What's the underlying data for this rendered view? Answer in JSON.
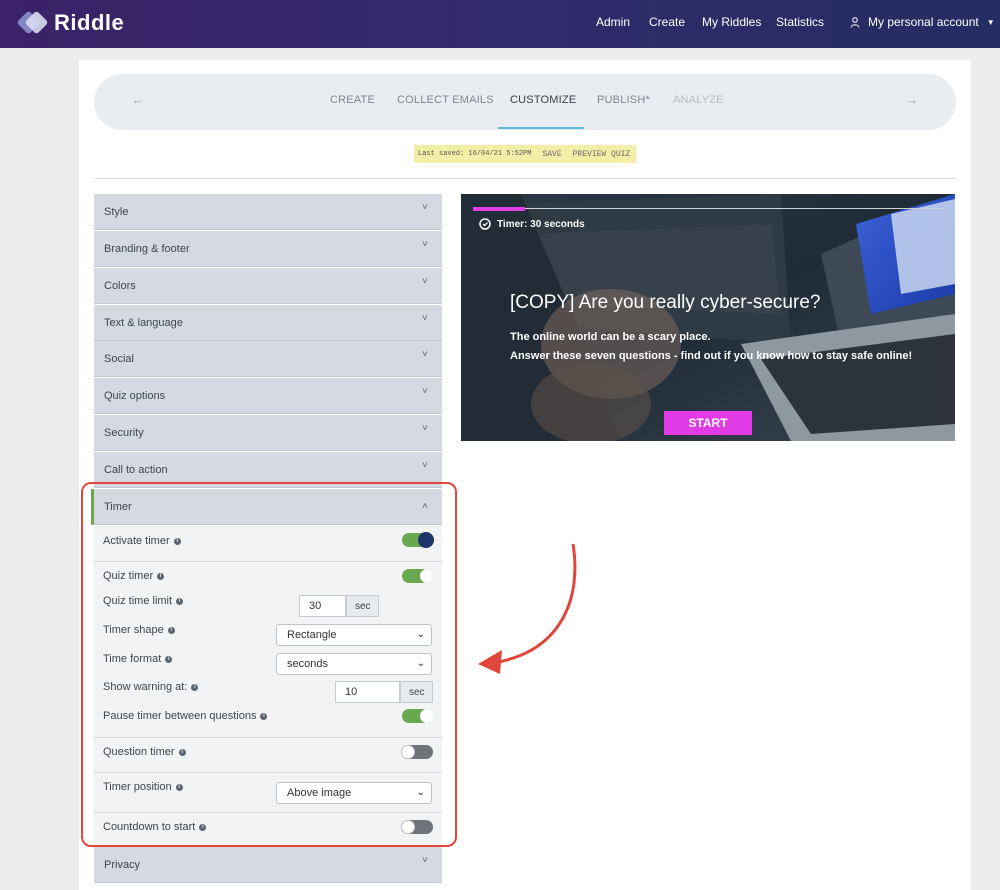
{
  "header": {
    "brand": "Riddle",
    "nav": [
      "Admin",
      "Create",
      "My Riddles",
      "Statistics"
    ],
    "account": "My personal account"
  },
  "steps": {
    "tabs": [
      {
        "label": "CREATE"
      },
      {
        "label": "COLLECT EMAILS"
      },
      {
        "label": "CUSTOMIZE"
      },
      {
        "label": "PUBLISH*"
      },
      {
        "label": "ANALYZE"
      }
    ],
    "active": "CUSTOMIZE"
  },
  "savebar": {
    "last_saved": "Last saved: 16/04/21 5:52PM",
    "save": "SAVE",
    "preview": "PREVIEW QUIZ"
  },
  "accordion": {
    "sections": [
      {
        "label": "Style"
      },
      {
        "label": "Branding & footer"
      },
      {
        "label": "Colors"
      },
      {
        "label": "Text & language"
      },
      {
        "label": "Social"
      },
      {
        "label": "Quiz options"
      },
      {
        "label": "Security"
      },
      {
        "label": "Call to action"
      },
      {
        "label": "Timer"
      },
      {
        "label": "Privacy"
      }
    ],
    "expanded": "Timer"
  },
  "timer": {
    "activate_timer": {
      "label": "Activate timer",
      "on": true
    },
    "quiz_timer": {
      "label": "Quiz timer",
      "on": true
    },
    "quiz_time_limit": {
      "label": "Quiz time limit",
      "value": "30",
      "unit": "sec"
    },
    "timer_shape": {
      "label": "Timer shape",
      "value": "Rectangle"
    },
    "time_format": {
      "label": "Time format",
      "value": "seconds"
    },
    "show_warning": {
      "label": "Show warning at:",
      "value": "10",
      "unit": "sec"
    },
    "pause_timer": {
      "label": "Pause timer between questions",
      "on": true
    },
    "question_timer": {
      "label": "Question timer",
      "on": false
    },
    "timer_position": {
      "label": "Timer position",
      "value": "Above image"
    },
    "countdown": {
      "label": "Countdown to start",
      "on": false
    }
  },
  "preview": {
    "timer_text": "Timer: 30 seconds",
    "title": "[COPY] Are you really cyber-secure?",
    "line1": "The online world can be a scary place.",
    "line2": "Answer these seven questions - find out if you know how to stay safe online!",
    "start": "START",
    "progress": 0.11
  },
  "colors": {
    "accent_magenta": "#e23ce6",
    "toggle_on": "#6aa84f",
    "highlight_red": "#e0463a"
  }
}
